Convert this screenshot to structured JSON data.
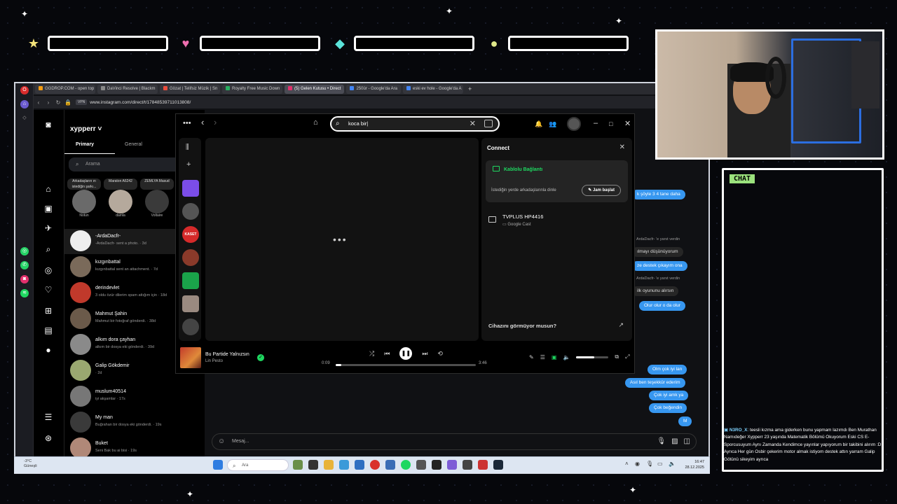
{
  "browser": {
    "tabs": [
      {
        "label": "GGDROP.COM - open top",
        "color": "#f39c12"
      },
      {
        "label": "DaVinci Resolve | Blackm",
        "color": "#888888"
      },
      {
        "label": "Gözat | Telifsiz Müzik | Sn",
        "color": "#e74c3c"
      },
      {
        "label": "Royalty Free Music Down",
        "color": "#27ae60"
      },
      {
        "label": "(5) Gelen Kutusu • Direct",
        "color": "#e1306c",
        "active": true
      },
      {
        "label": "250ür - Google'da Ara",
        "color": "#4285f4"
      },
      {
        "label": "eski ev hole - Google'da A",
        "color": "#4285f4"
      }
    ],
    "new_tab": "+",
    "vpn_label": "VPN",
    "url": "www.instagram.com/direct/t/17848539711013808/"
  },
  "instagram": {
    "username": "xypperr",
    "tabs": {
      "primary": "Primary",
      "general": "General"
    },
    "search_placeholder": "Arama",
    "notes": [
      {
        "bubble": "Arkadaşların ın istediğin şarkı...",
        "name": "Notun"
      },
      {
        "bubble": "Maraton A6242",
        "name": "damla"
      },
      {
        "bubble": "ZEMLYA Masud",
        "name": "Voltaire"
      }
    ],
    "conversations": [
      {
        "name": "-ArdaDacfr-",
        "preview": "-ArdaDacfr- sent a photo. · 3d",
        "color": "#eeeeee"
      },
      {
        "name": "kızgınbattal",
        "preview": "kızgınbattal sent an attachment. · 7d",
        "color": "#7a6a5a"
      },
      {
        "name": "derindevlet",
        "preview": "3 oldu özür dilerim spam attığım için · 18d",
        "color": "#c0392b"
      },
      {
        "name": "Mahmut Şahin",
        "preview": "Mahmut bir fotoğraf gönderdi. · 38d",
        "color": "#6b5a4a"
      },
      {
        "name": "alkım dora çayhan",
        "preview": "alkım bir dosya eki gönderdi. · 39d",
        "color": "#8a8a8a"
      },
      {
        "name": "Galip Gökdemir",
        "preview": "· 2d",
        "color": "#9aa870"
      },
      {
        "name": "muslum40514",
        "preview": "iyi akşamlar · 17s",
        "color": "#777777"
      },
      {
        "name": "My man",
        "preview": "Buğrahan bir dosya eki gönderdi. · 19s",
        "color": "#3a3a3a"
      },
      {
        "name": "Buket",
        "preview": "Seni Bak bu ai bisi · 19s",
        "color": "#b08878"
      }
    ],
    "thread": {
      "blue_top": "k şöyle 3 4 tane daha",
      "system": [
        "ArdaDacfr- 'e yanıt verdin",
        "ArdaDacfr- 'e yanıt verdin"
      ],
      "gray": [
        "ılmayı düşünüyorum",
        "ilk oyununu alırsın"
      ],
      "blue": [
        "ze destek çıkayım ona",
        "Olur olur o da olur"
      ],
      "bottom": [
        "Olm çok iyi lan",
        "Asıl ben teşekkür ederim",
        "Çok iyi amk ya",
        "Çok beğendin",
        "M"
      ]
    },
    "composer_placeholder": "Mesaj..."
  },
  "spotify": {
    "search_value": "koca bir",
    "connect": {
      "title": "Connect",
      "wired_label": "Kablolu Bağlantı",
      "listen_anywhere": "İstediğin yerde arkadaşlarınla dinle",
      "jam_button": "Jam başlat",
      "device_name": "TVPLUS HP4416",
      "device_type": "Google Cast",
      "not_seeing": "Cihazını görmüyor musun?"
    },
    "library_tiles": [
      {
        "color": "#7b4de8"
      },
      {
        "color": "#555555"
      },
      {
        "color": "#d62a2a",
        "label": "KASET"
      },
      {
        "color": "#8a3a2a"
      },
      {
        "color": "#1aa34a"
      },
      {
        "color": "#9a8a80"
      },
      {
        "color": "#444444"
      }
    ],
    "track_title": "Bu Partide Yalnızsın",
    "track_artist": "Lin Pesto",
    "elapsed": "0:09",
    "duration": "3:46",
    "progress": 0.04,
    "volume": 0.55
  },
  "taskbar": {
    "weather_temp": "-3°C",
    "weather_desc": "Güneşli",
    "search_placeholder": "Ara",
    "time": "16:47",
    "date": "28.12.2025"
  },
  "overlay": {
    "chat_tag": "CHAT",
    "chat_user": "N3RO_X",
    "chat_text": ": teesli kızma ama giderken bunu yapmam lazımdı Ben Murathan Namıdeğer Xypperr 23 yaşında Matematik Bölümü Okuyorum Eski CS E-Sporcusuyum Aynı Zamanda Kendimce yayınlar yapıyorum bir takibini alırım :D Ayrıca Her gün Osbir çekerim motor almak istiyom destek attın yarram Galip Götünü sikeyim ayrıca"
  }
}
